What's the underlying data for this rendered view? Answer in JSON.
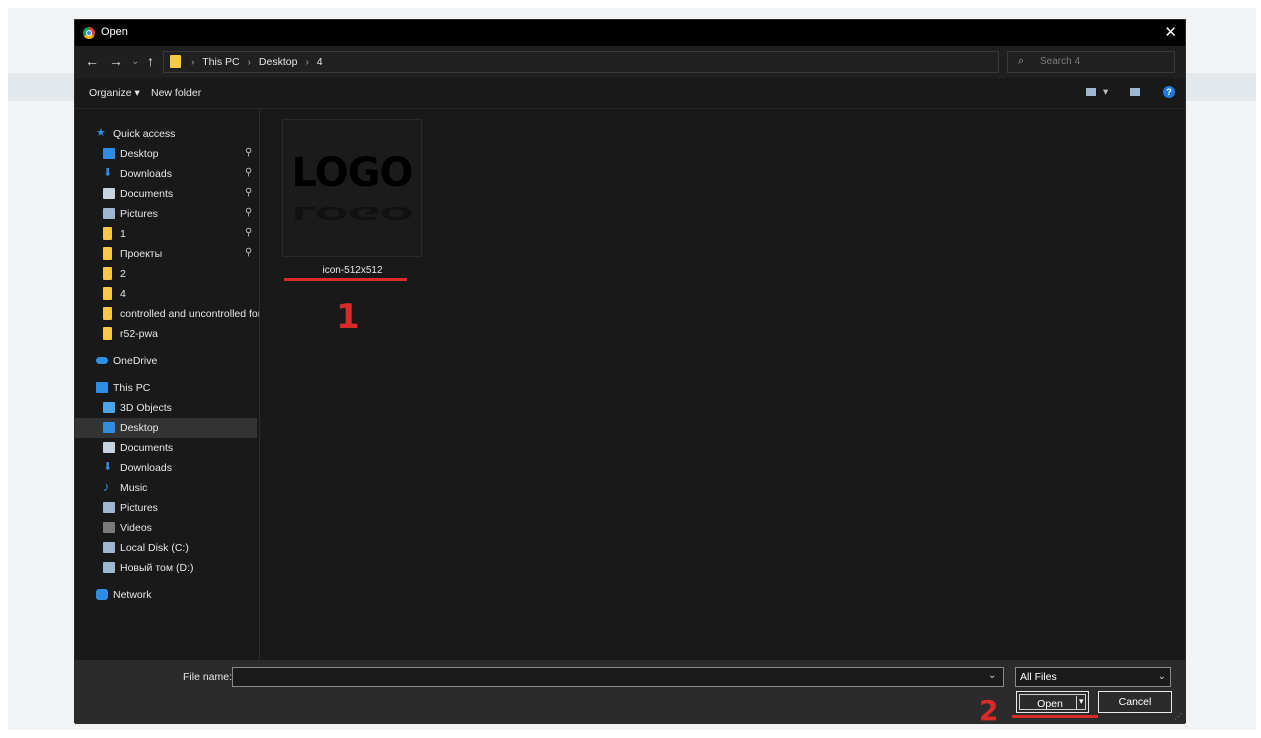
{
  "dialog": {
    "title": "Open",
    "close_glyph": "✕",
    "brand_icon": "chrome-icon"
  },
  "nav": {
    "back": "←",
    "forward": "→",
    "recent": "⌄",
    "up": "↑"
  },
  "address": {
    "crumbs": [
      "This PC",
      "Desktop",
      "4"
    ],
    "separator": "›",
    "dropdown_glyph": "⌄",
    "refresh_glyph": "↻"
  },
  "search": {
    "icon_glyph": "⌕",
    "placeholder": "Search 4"
  },
  "toolbar": {
    "organize": "Organize ▾",
    "new_folder": "New folder",
    "view_dropdown": "▾",
    "help": "?"
  },
  "sidebar": {
    "pin_glyph": "📌",
    "items": [
      {
        "label": "Quick access",
        "icon": "star-icon",
        "color": "#2f8de4"
      },
      {
        "label": "Desktop",
        "icon": "desktop-folder-icon",
        "color": "#2f8de4",
        "pinned": true
      },
      {
        "label": "Downloads",
        "icon": "download-icon",
        "color": "#2f8de4",
        "pinned": true
      },
      {
        "label": "Documents",
        "icon": "documents-icon",
        "color": "#c8d4e0",
        "pinned": true
      },
      {
        "label": "Pictures",
        "icon": "pictures-icon",
        "color": "#9fb6d0",
        "pinned": true
      },
      {
        "label": "1",
        "icon": "folder-icon",
        "color": "#f6c944",
        "pinned": true
      },
      {
        "label": "Проекты",
        "icon": "folder-icon",
        "color": "#f6c944",
        "pinned": true
      },
      {
        "label": "2",
        "icon": "folder-icon",
        "color": "#f6c944"
      },
      {
        "label": "4",
        "icon": "folder-icon",
        "color": "#f6c944"
      },
      {
        "label": "controlled and uncontrolled for",
        "icon": "folder-icon",
        "color": "#f6c944"
      },
      {
        "label": "r52-pwa",
        "icon": "folder-icon",
        "color": "#f6c944"
      },
      {
        "label": "OneDrive",
        "icon": "cloud-icon",
        "color": "#2f8de4"
      },
      {
        "label": "This PC",
        "icon": "computer-icon",
        "color": "#2f8de4"
      },
      {
        "label": "3D Objects",
        "icon": "cube-icon",
        "color": "#4fa3e6"
      },
      {
        "label": "Desktop",
        "icon": "desktop-folder-icon",
        "color": "#2f8de4",
        "selected": true
      },
      {
        "label": "Documents",
        "icon": "documents-icon",
        "color": "#c8d4e0"
      },
      {
        "label": "Downloads",
        "icon": "download-icon",
        "color": "#2f8de4"
      },
      {
        "label": "Music",
        "icon": "music-icon",
        "color": "#2f8de4"
      },
      {
        "label": "Pictures",
        "icon": "pictures-icon",
        "color": "#9fb6d0"
      },
      {
        "label": "Videos",
        "icon": "videos-icon",
        "color": "#7a7a7a"
      },
      {
        "label": "Local Disk (C:)",
        "icon": "drive-icon",
        "color": "#9fb6d0"
      },
      {
        "label": "Новый том (D:)",
        "icon": "drive-icon",
        "color": "#9fb6d0"
      },
      {
        "label": "Network",
        "icon": "network-icon",
        "color": "#2f8de4"
      }
    ]
  },
  "files": [
    {
      "name": "icon-512x512",
      "thumbnail_text": "LOGO"
    }
  ],
  "bottom": {
    "filename_label": "File name:",
    "filename_value": "",
    "dropdown_glyph": "⌄",
    "filter_value": "All Files",
    "filter_arrow": "⌄",
    "open_label": "Open",
    "open_split": "▾",
    "cancel_label": "Cancel",
    "grip": "⋰"
  },
  "annotations": [
    {
      "number": "1",
      "color": "#d92a2a"
    },
    {
      "number": "2",
      "color": "#d92a2a"
    }
  ]
}
